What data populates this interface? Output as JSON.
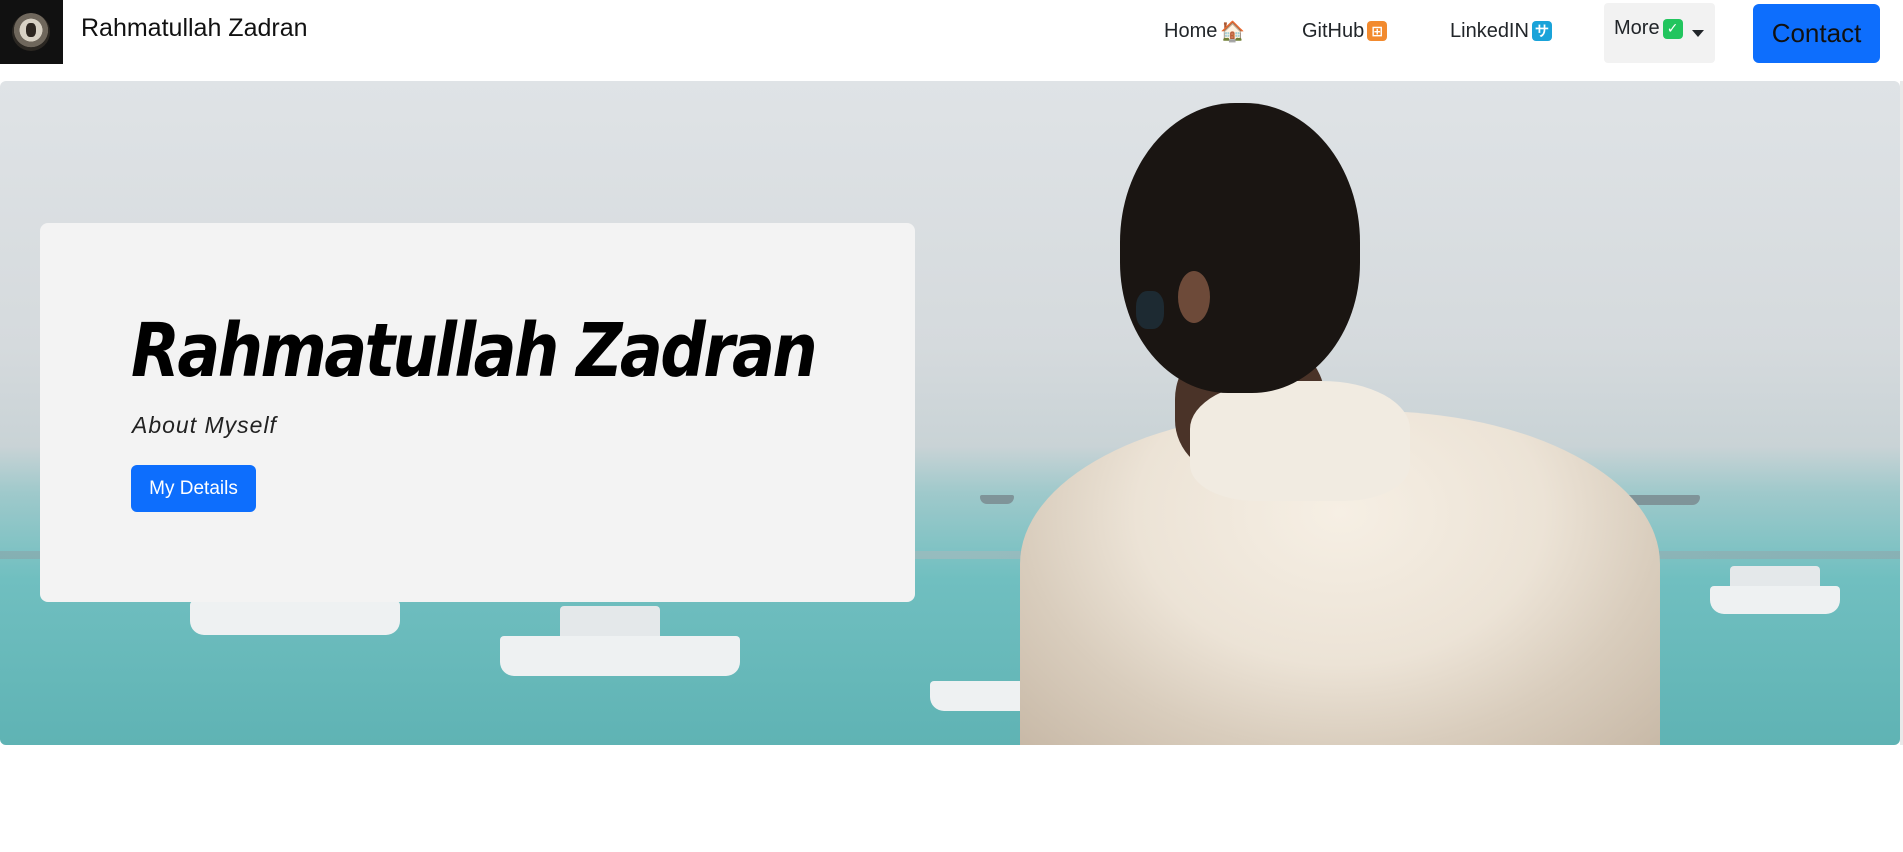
{
  "navbar": {
    "brand_name": "Rahmatullah Zadran",
    "links": [
      {
        "label": "Home",
        "emoji": "🏠"
      },
      {
        "label": "GitHub",
        "emoji": "⊞"
      },
      {
        "label": "LinkedIN",
        "emoji": "サ"
      }
    ],
    "more": {
      "label": "More",
      "emoji": "✓"
    },
    "contact_label": "Contact"
  },
  "hero": {
    "title": "Rahmatullah Zadran",
    "subtitle": "About Myself",
    "button_label": "My Details"
  },
  "colors": {
    "primary": "#0d6efd",
    "card_bg": "#f3f3f3",
    "github_emoji_bg": "#f28a2e",
    "linkedin_emoji_bg": "#1aa3d9",
    "more_emoji_bg": "#22c55e"
  },
  "icons": {
    "home": "house-icon",
    "github": "orange-square-icon",
    "linkedin": "blue-square-icon",
    "more": "check-mark-icon",
    "dropdown": "caret-down-icon"
  }
}
